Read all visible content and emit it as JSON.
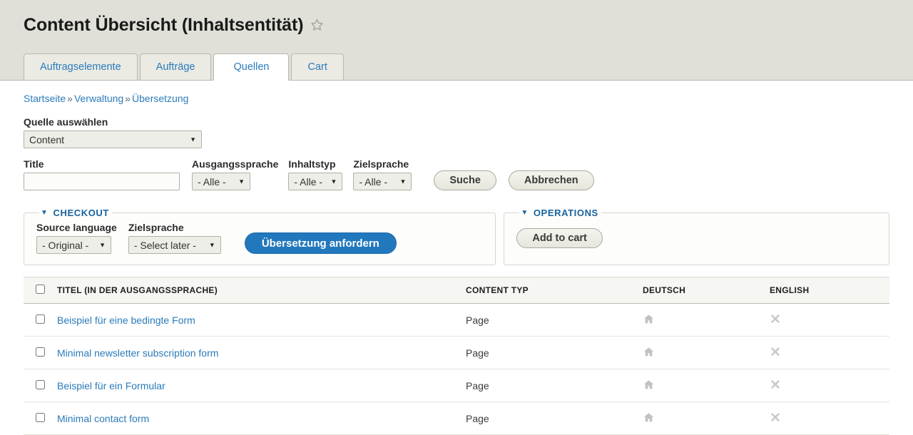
{
  "header": {
    "title": "Content Übersicht (Inhaltsentität)",
    "star_icon": "star-outline-icon"
  },
  "tabs": [
    {
      "label": "Auftragselemente",
      "active": false
    },
    {
      "label": "Aufträge",
      "active": false
    },
    {
      "label": "Quellen",
      "active": true
    },
    {
      "label": "Cart",
      "active": false
    }
  ],
  "breadcrumb": {
    "items": [
      "Startseite",
      "Verwaltung",
      "Übersetzung"
    ],
    "separator": "»"
  },
  "source_select": {
    "label": "Quelle auswählen",
    "value": "Content",
    "arrow_icon": "chevron-down-icon"
  },
  "filters": {
    "title": {
      "label": "Title",
      "value": "",
      "placeholder": ""
    },
    "source_language": {
      "label": "Ausgangssprache",
      "value": "- Alle -"
    },
    "content_type": {
      "label": "Inhaltstyp",
      "value": "- Alle -"
    },
    "target_language": {
      "label": "Zielsprache",
      "value": "- Alle -"
    },
    "search_button": "Suche",
    "cancel_button": "Abbrechen"
  },
  "checkout": {
    "legend": "CHECKOUT",
    "toggle_icon": "triangle-down-icon",
    "source_language": {
      "label": "Source language",
      "value": "- Original -"
    },
    "target_language": {
      "label": "Zielsprache",
      "value": "- Select later -"
    },
    "submit_button": "Übersetzung anfordern"
  },
  "operations": {
    "legend": "OPERATIONS",
    "toggle_icon": "triangle-down-icon",
    "add_to_cart_button": "Add to cart"
  },
  "table": {
    "columns": [
      "TITEL (IN DER AUSGANGSSPRACHE)",
      "CONTENT TYP",
      "DEUTSCH",
      "ENGLISH"
    ],
    "rows": [
      {
        "title": "Beispiel für eine bedingte Form",
        "content_type": "Page",
        "deutsch_icon": "home-icon",
        "english_icon": "cross-icon"
      },
      {
        "title": "Minimal newsletter subscription form",
        "content_type": "Page",
        "deutsch_icon": "home-icon",
        "english_icon": "cross-icon"
      },
      {
        "title": "Beispiel für ein Formular",
        "content_type": "Page",
        "deutsch_icon": "home-icon",
        "english_icon": "cross-icon"
      },
      {
        "title": "Minimal contact form",
        "content_type": "Page",
        "deutsch_icon": "home-icon",
        "english_icon": "cross-icon"
      }
    ]
  },
  "colors": {
    "link": "#2b7bba",
    "legend": "#17639e",
    "primary_button": "#2278bd",
    "header_band": "#e0e0d8",
    "icon_grey": "#c2c2c2"
  }
}
